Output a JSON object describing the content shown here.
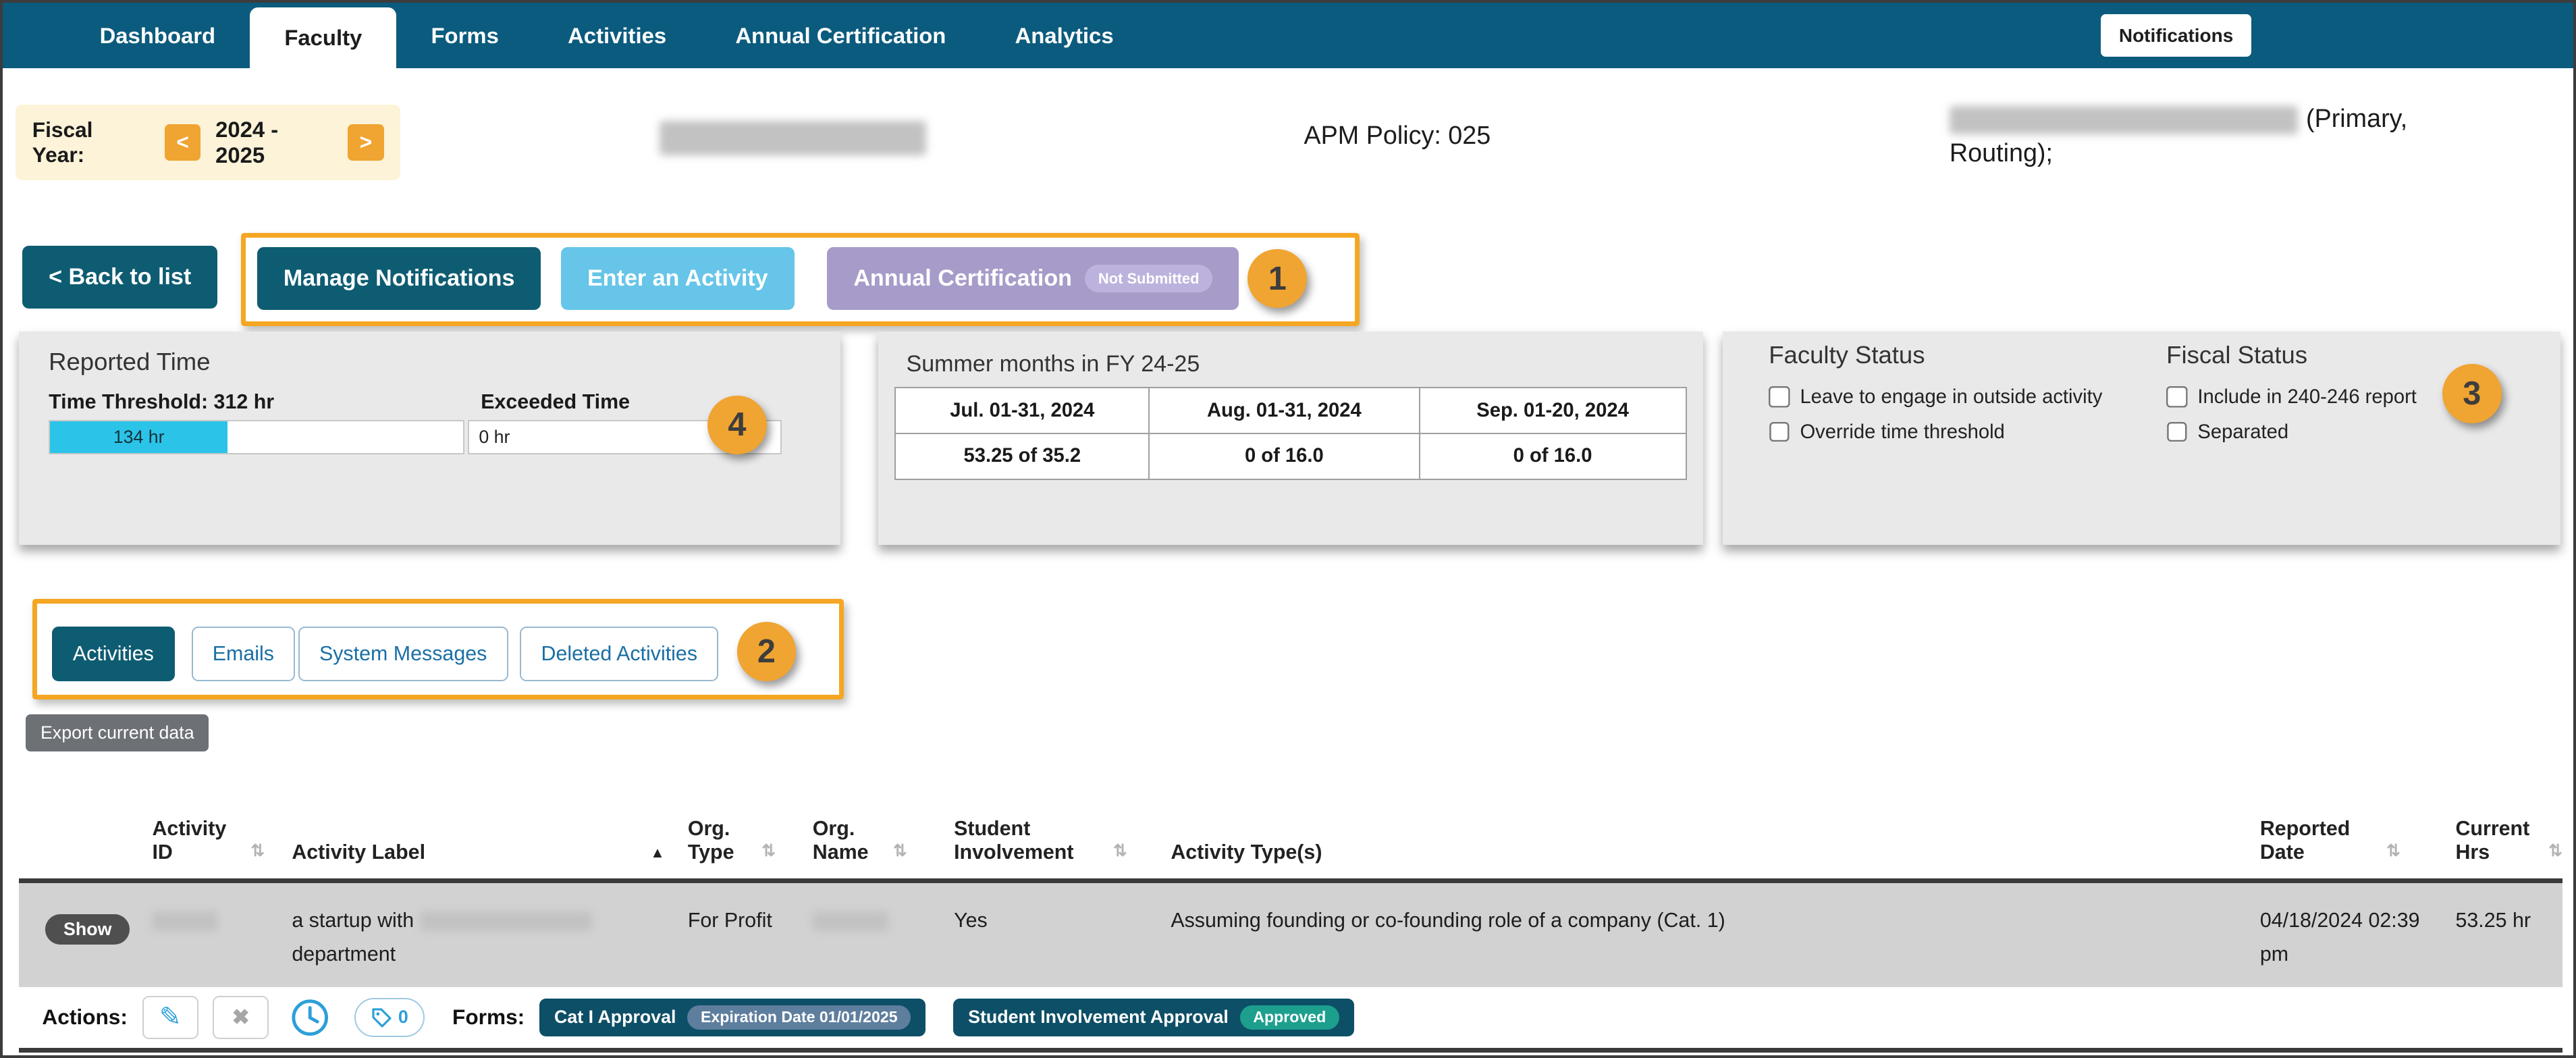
{
  "nav": {
    "items": [
      "Dashboard",
      "Faculty",
      "Forms",
      "Activities",
      "Annual Certification",
      "Analytics"
    ],
    "notifications_label": "Notifications"
  },
  "header": {
    "fiscal_year_label": "Fiscal Year:",
    "fiscal_year_prev": "<",
    "fiscal_year_next": ">",
    "fiscal_year_value": "2024 - 2025",
    "apm_policy": "APM Policy: 025",
    "affiliation_suffix": "(Primary, Routing);"
  },
  "buttons": {
    "back_to_list": "< Back to list",
    "manage_notifications": "Manage Notifications",
    "enter_activity": "Enter an Activity",
    "annual_certification": "Annual Certification",
    "annual_certification_status": "Not Submitted"
  },
  "callouts": [
    "1",
    "2",
    "3",
    "4"
  ],
  "reported_time": {
    "title": "Reported Time",
    "threshold_label": "Time Threshold: 312 hr",
    "exceeded_label": "Exceeded Time",
    "reported_value": "134 hr",
    "exceeded_value": "0 hr"
  },
  "summer": {
    "title": "Summer months in FY 24-25",
    "columns": [
      "Jul. 01-31, 2024",
      "Aug. 01-31, 2024",
      "Sep. 01-20, 2024"
    ],
    "values": [
      "53.25 of 35.2",
      "0 of 16.0",
      "0 of 16.0"
    ]
  },
  "status": {
    "faculty_title": "Faculty Status",
    "faculty_options": [
      "Leave to engage in outside activity",
      "Override time threshold"
    ],
    "fiscal_title": "Fiscal Status",
    "fiscal_options": [
      "Include in 240-246 report",
      "Separated"
    ]
  },
  "tabs": [
    "Activities",
    "Emails",
    "System Messages",
    "Deleted Activities"
  ],
  "export_label": "Export current data",
  "table": {
    "headers": [
      "Activity ID",
      "Activity Label",
      "Org. Type",
      "Org. Name",
      "Student Involvement",
      "Activity Type(s)",
      "Reported Date",
      "Current Hrs"
    ],
    "row": {
      "show_label": "Show",
      "activity_label_prefix": "a startup with",
      "activity_label_suffix": "department",
      "org_type": "For Profit",
      "student_involvement": "Yes",
      "activity_types": "Assuming founding or co-founding role of a company (Cat. 1)",
      "reported_date": "04/18/2024 02:39 pm",
      "current_hrs": "53.25 hr"
    }
  },
  "actions_bar": {
    "actions_label": "Actions:",
    "forms_label": "Forms:",
    "tag_count": "0",
    "forms": [
      {
        "label": "Cat I Approval",
        "badge": "Expiration Date 01/01/2025"
      },
      {
        "label": "Student Involvement Approval",
        "badge": "Approved"
      }
    ]
  },
  "icons": {
    "sort": "⇅",
    "sort_asc": "▲",
    "edit": "✎",
    "delete": "✖"
  },
  "colors": {
    "accent_orange": "#f5a623",
    "nav_teal": "#0b5b7e",
    "button_teal": "#0e5c72",
    "cyan_button": "#66c5e8",
    "lavender_button": "#a79bc9",
    "progress_cyan": "#2cc3e8"
  }
}
